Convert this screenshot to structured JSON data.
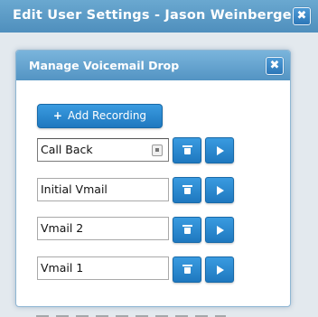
{
  "outer": {
    "title": "Edit User Settings - Jason Weinberger",
    "close_icon": "✖"
  },
  "dialog": {
    "title": "Manage Voicemail Drop",
    "close_icon": "✖",
    "add_button": {
      "icon": "+",
      "label": "Add Recording"
    },
    "recordings": [
      {
        "name": "Call Back"
      },
      {
        "name": "Initial Vmail"
      },
      {
        "name": "Vmail 2"
      },
      {
        "name": "Vmail 1"
      }
    ]
  }
}
